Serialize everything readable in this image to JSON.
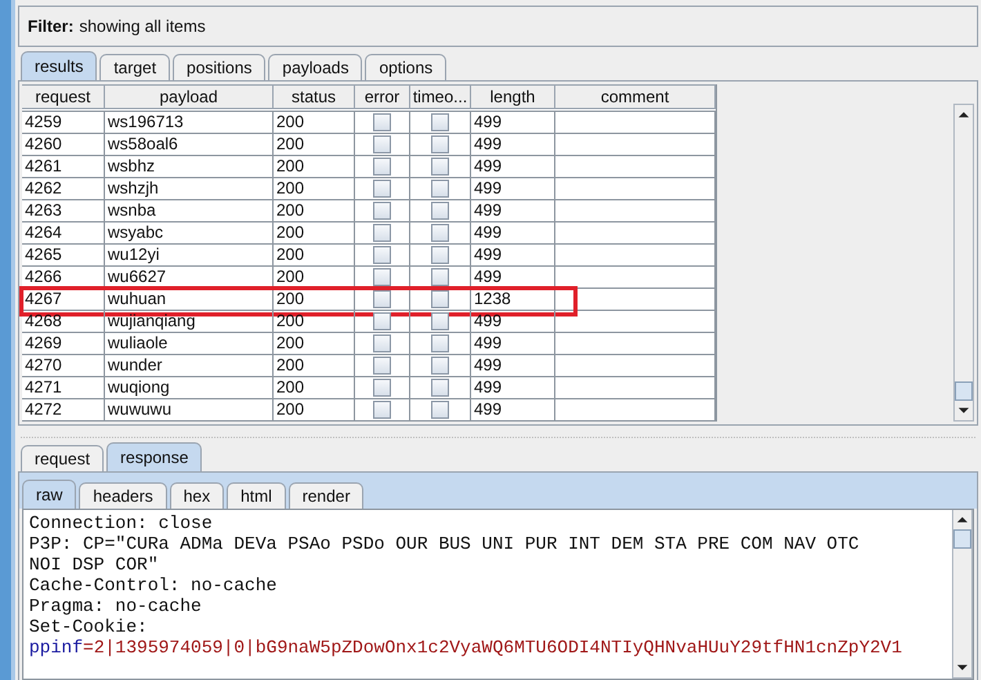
{
  "filter": {
    "label": "Filter:",
    "text": "showing all items"
  },
  "tabs": [
    {
      "label": "results",
      "selected": true
    },
    {
      "label": "target",
      "selected": false
    },
    {
      "label": "positions",
      "selected": false
    },
    {
      "label": "payloads",
      "selected": false
    },
    {
      "label": "options",
      "selected": false
    }
  ],
  "table": {
    "columns": [
      "request",
      "payload",
      "status",
      "error",
      "timeo...",
      "length",
      "comment"
    ],
    "rows": [
      {
        "request": "4259",
        "payload": "ws196713",
        "status": "200",
        "error": false,
        "timeout": false,
        "length": "499",
        "highlighted": false
      },
      {
        "request": "4260",
        "payload": "ws58oal6",
        "status": "200",
        "error": false,
        "timeout": false,
        "length": "499",
        "highlighted": false
      },
      {
        "request": "4261",
        "payload": "wsbhz",
        "status": "200",
        "error": false,
        "timeout": false,
        "length": "499",
        "highlighted": false
      },
      {
        "request": "4262",
        "payload": "wshzjh",
        "status": "200",
        "error": false,
        "timeout": false,
        "length": "499",
        "highlighted": false
      },
      {
        "request": "4263",
        "payload": "wsnba",
        "status": "200",
        "error": false,
        "timeout": false,
        "length": "499",
        "highlighted": false
      },
      {
        "request": "4264",
        "payload": "wsyabc",
        "status": "200",
        "error": false,
        "timeout": false,
        "length": "499",
        "highlighted": false
      },
      {
        "request": "4265",
        "payload": "wu12yi",
        "status": "200",
        "error": false,
        "timeout": false,
        "length": "499",
        "highlighted": false
      },
      {
        "request": "4266",
        "payload": "wu6627",
        "status": "200",
        "error": false,
        "timeout": false,
        "length": "499",
        "highlighted": false
      },
      {
        "request": "4267",
        "payload": "wuhuan",
        "status": "200",
        "error": false,
        "timeout": false,
        "length": "1238",
        "highlighted": true
      },
      {
        "request": "4268",
        "payload": "wujianqiang",
        "status": "200",
        "error": false,
        "timeout": false,
        "length": "499",
        "highlighted": false
      },
      {
        "request": "4269",
        "payload": "wuliaole",
        "status": "200",
        "error": false,
        "timeout": false,
        "length": "499",
        "highlighted": false
      },
      {
        "request": "4270",
        "payload": "wunder",
        "status": "200",
        "error": false,
        "timeout": false,
        "length": "499",
        "highlighted": false
      },
      {
        "request": "4271",
        "payload": "wuqiong",
        "status": "200",
        "error": false,
        "timeout": false,
        "length": "499",
        "highlighted": false
      },
      {
        "request": "4272",
        "payload": "wuwuwu",
        "status": "200",
        "error": false,
        "timeout": false,
        "length": "499",
        "highlighted": false
      }
    ]
  },
  "message_tabs": [
    {
      "label": "request",
      "selected": false
    },
    {
      "label": "response",
      "selected": true
    }
  ],
  "view_tabs": [
    {
      "label": "raw",
      "selected": true
    },
    {
      "label": "headers",
      "selected": false
    },
    {
      "label": "hex",
      "selected": false
    },
    {
      "label": "html",
      "selected": false
    },
    {
      "label": "render",
      "selected": false
    }
  ],
  "response_lines": [
    {
      "kind": "text",
      "text": "Connection: close"
    },
    {
      "kind": "text",
      "text": "P3P: CP=\"CURa ADMa DEVa PSAo PSDo OUR BUS UNI PUR INT DEM STA PRE COM NAV OTC"
    },
    {
      "kind": "text",
      "text": "NOI DSP COR\""
    },
    {
      "kind": "text",
      "text": "Cache-Control: no-cache"
    },
    {
      "kind": "text",
      "text": "Pragma: no-cache"
    },
    {
      "kind": "text",
      "text": "Set-Cookie:"
    },
    {
      "kind": "cookie",
      "name": "ppinf",
      "value": "=2|1395974059|0|bG9naW5pZDowOnx1c2VyaWQ6MTU6ODI4NTIyQHNvaHUuY29tfHN1cnZpY2V1"
    }
  ]
}
